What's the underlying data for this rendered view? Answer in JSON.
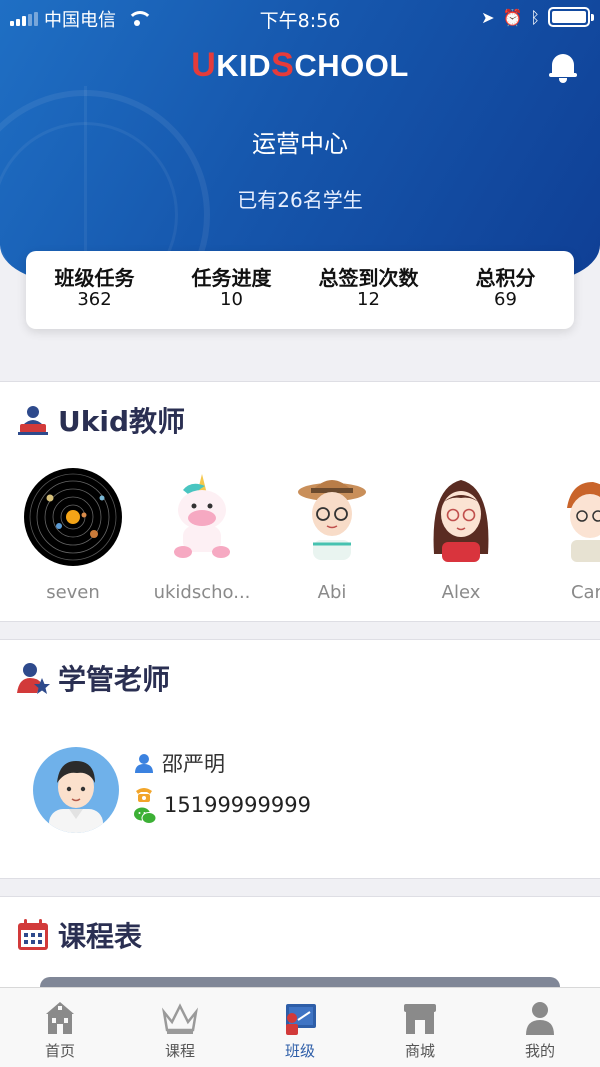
{
  "status_bar": {
    "carrier": "中国电信",
    "time": "下午8:56"
  },
  "header": {
    "logo": {
      "u": "U",
      "k": "K",
      "id": "ID",
      "s": "S",
      "chool": "CHOOL"
    },
    "title": "运营中心",
    "subtitle": "已有26名学生"
  },
  "stats": [
    {
      "label": "班级任务",
      "value": "362"
    },
    {
      "label": "任务进度",
      "value": "10"
    },
    {
      "label": "总签到次数",
      "value": "12"
    },
    {
      "label": "总积分",
      "value": "69"
    }
  ],
  "teachers_section": {
    "title": "Ukid教师",
    "teachers": [
      {
        "name": "seven",
        "avatar": "solar-system-avatar"
      },
      {
        "name": "ukidscho...",
        "avatar": "unicorn-avatar"
      },
      {
        "name": "Abi",
        "avatar": "girl-hat-avatar"
      },
      {
        "name": "Alex",
        "avatar": "girl-glasses-avatar"
      },
      {
        "name": "Carr",
        "avatar": "boy-avatar"
      }
    ]
  },
  "manager_section": {
    "title": "学管老师",
    "name": "邵严明",
    "phone": "15199999999"
  },
  "schedule_section": {
    "title": "课程表"
  },
  "tabbar": {
    "items": [
      {
        "label": "首页",
        "icon": "home-icon",
        "active": false
      },
      {
        "label": "课程",
        "icon": "crown-icon",
        "active": false
      },
      {
        "label": "班级",
        "icon": "class-icon",
        "active": true
      },
      {
        "label": "商城",
        "icon": "shop-icon",
        "active": false
      },
      {
        "label": "我的",
        "icon": "profile-icon",
        "active": false
      }
    ]
  },
  "colors": {
    "header_start": "#1f6fc4",
    "header_end": "#0f3f95",
    "title_text": "#2a2f52",
    "tab_active": "#2e5ea8",
    "logo_red": "#e53b3b"
  }
}
